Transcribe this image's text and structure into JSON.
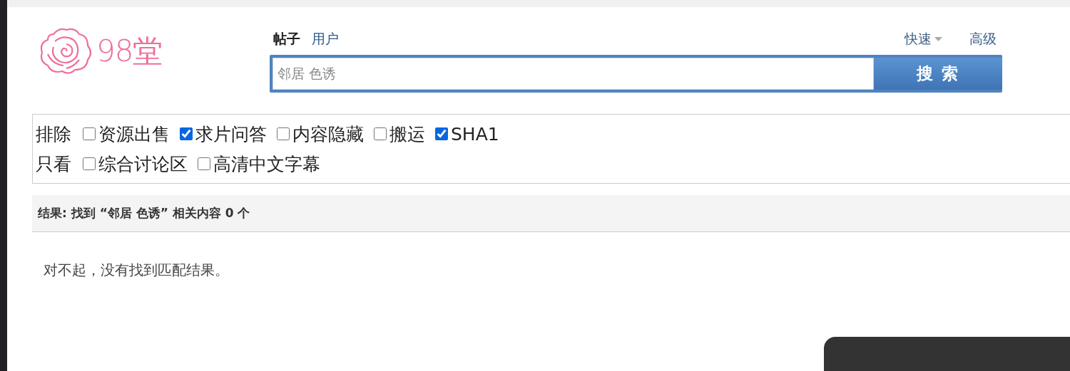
{
  "logo": {
    "text": "98堂"
  },
  "search_tabs": [
    {
      "label": "帖子",
      "selected": true
    },
    {
      "label": "用户",
      "selected": false
    }
  ],
  "search_links": [
    {
      "label": "快速",
      "kind": "dropdown"
    },
    {
      "label": "高级",
      "kind": "link"
    }
  ],
  "search": {
    "value": "邻居 色诱",
    "button": "搜 索"
  },
  "filters": [
    {
      "label": "排除",
      "options": [
        {
          "label": "资源出售",
          "checked": false
        },
        {
          "label": "求片问答",
          "checked": true
        },
        {
          "label": "内容隐藏",
          "checked": false
        },
        {
          "label": "搬运",
          "checked": false
        },
        {
          "label": "SHA1",
          "checked": true
        }
      ]
    },
    {
      "label": "只看",
      "options": [
        {
          "label": "综合讨论区",
          "checked": false
        },
        {
          "label": "高清中文字幕",
          "checked": false
        }
      ]
    }
  ],
  "results": {
    "summary": "结果: 找到 “邻居 色诱” 相关内容 0 个",
    "message": "对不起，没有找到匹配结果。"
  }
}
